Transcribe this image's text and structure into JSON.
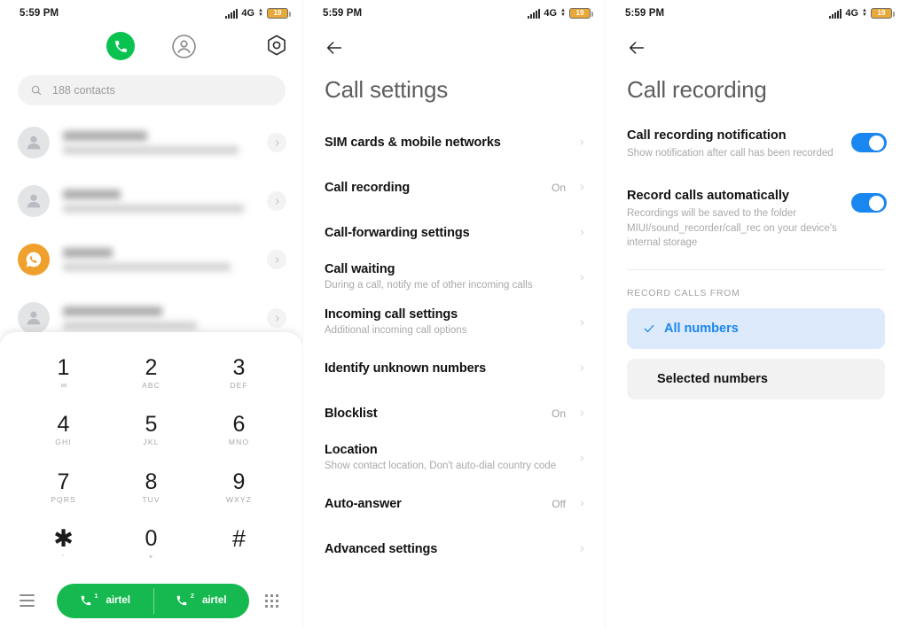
{
  "status_bar": {
    "time": "5:59 PM",
    "network": "4G",
    "battery_level": "19",
    "signal_icon": "signal-bars-icon",
    "battery_icon": "battery-icon"
  },
  "colors": {
    "call_green": "#15b94f",
    "tab_green": "#0ac250",
    "toggle_blue": "#1a86f0",
    "selected_row_bg": "#ddeafb",
    "plain_row_bg": "#f2f2f3",
    "battery_orange": "#e8a93a",
    "avatar_orange": "#f0a02c"
  },
  "dialer": {
    "tabs": [
      {
        "name": "phone-tab",
        "icon": "phone-icon",
        "active": true
      },
      {
        "name": "contacts-tab",
        "icon": "person-circle-icon",
        "active": false
      },
      {
        "name": "settings-tab",
        "icon": "gear-hexagon-icon",
        "active": false
      }
    ],
    "search": {
      "icon": "search-icon",
      "value": "188 contacts",
      "placeholder": "188 contacts"
    },
    "contacts": [
      {
        "avatar": "person-icon",
        "avatar_style": "gray",
        "name_redacted": true,
        "sub_redacted": true
      },
      {
        "avatar": "person-icon",
        "avatar_style": "gray",
        "name_redacted": true,
        "sub_redacted": true
      },
      {
        "avatar": "whatsapp-call-icon",
        "avatar_style": "orange",
        "name_redacted": true,
        "sub_redacted": true
      },
      {
        "avatar": "person-icon",
        "avatar_style": "gray",
        "name_redacted": true,
        "sub_redacted": true
      }
    ],
    "keypad": [
      {
        "digit": "1",
        "sub": "∞",
        "sub_kind": "voicemail"
      },
      {
        "digit": "2",
        "sub": "ABC",
        "sub_kind": "letters"
      },
      {
        "digit": "3",
        "sub": "DEF",
        "sub_kind": "letters"
      },
      {
        "digit": "4",
        "sub": "GHI",
        "sub_kind": "letters"
      },
      {
        "digit": "5",
        "sub": "JKL",
        "sub_kind": "letters"
      },
      {
        "digit": "6",
        "sub": "MNO",
        "sub_kind": "letters"
      },
      {
        "digit": "7",
        "sub": "PQRS",
        "sub_kind": "letters"
      },
      {
        "digit": "8",
        "sub": "TUV",
        "sub_kind": "letters"
      },
      {
        "digit": "9",
        "sub": "WXYZ",
        "sub_kind": "letters"
      },
      {
        "digit": "✱",
        "sub": "'",
        "sub_kind": "symbol"
      },
      {
        "digit": "0",
        "sub": "+",
        "sub_kind": "symbol"
      },
      {
        "digit": "#",
        "sub": "",
        "sub_kind": "symbol"
      }
    ],
    "bottom_bar": {
      "menu_icon": "hamburger-menu-icon",
      "keypad_icon": "dialpad-grid-icon",
      "call_buttons": [
        {
          "sim": "1",
          "operator": "airtel",
          "icon": "phone-call-icon"
        },
        {
          "sim": "2",
          "operator": "airtel",
          "icon": "phone-call-icon"
        }
      ]
    }
  },
  "call_settings": {
    "back_icon": "back-arrow-icon",
    "title": "Call settings",
    "items": [
      {
        "title": "SIM cards & mobile networks",
        "subtitle": "",
        "value": "",
        "chevron": true
      },
      {
        "title": "Call recording",
        "subtitle": "",
        "value": "On",
        "chevron": true
      },
      {
        "title": "Call-forwarding settings",
        "subtitle": "",
        "value": "",
        "chevron": true
      },
      {
        "title": "Call waiting",
        "subtitle": "During a call, notify me of other incoming calls",
        "value": "",
        "chevron": true
      },
      {
        "title": "Incoming call settings",
        "subtitle": "Additional incoming call options",
        "value": "",
        "chevron": true
      },
      {
        "title": "Identify unknown numbers",
        "subtitle": "",
        "value": "",
        "chevron": true
      },
      {
        "title": "Blocklist",
        "subtitle": "",
        "value": "On",
        "chevron": true
      },
      {
        "title": "Location",
        "subtitle": "Show contact location, Don't auto-dial country code",
        "value": "",
        "chevron": true
      },
      {
        "title": "Auto-answer",
        "subtitle": "",
        "value": "Off",
        "chevron": true
      },
      {
        "title": "Advanced settings",
        "subtitle": "",
        "value": "",
        "chevron": true
      }
    ]
  },
  "call_recording": {
    "back_icon": "back-arrow-icon",
    "title": "Call recording",
    "toggles": [
      {
        "title": "Call recording notification",
        "subtitle": "Show notification after call has been recorded",
        "state": "on"
      },
      {
        "title": "Record calls automatically",
        "subtitle": "Recordings will be saved to the folder MIUI/sound_recorder/call_rec on your device's internal storage",
        "state": "on"
      }
    ],
    "section_label": "RECORD CALLS FROM",
    "options": [
      {
        "label": "All numbers",
        "selected": true,
        "check_icon": "check-icon"
      },
      {
        "label": "Selected numbers",
        "selected": false,
        "check_icon": ""
      }
    ]
  }
}
